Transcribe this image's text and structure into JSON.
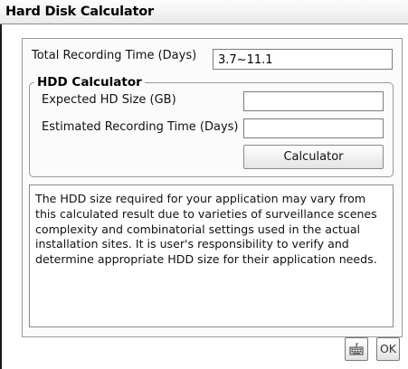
{
  "window": {
    "title": "Hard Disk Calculator"
  },
  "recording": {
    "total_label": "Total Recording Time (Days)",
    "total_value": "3.7~11.1"
  },
  "hdd_calculator": {
    "group_title": "HDD Calculator",
    "expected_size_label": "Expected HD Size (GB)",
    "expected_size_value": "",
    "estimated_time_label": "Estimated Recording Time (Days)",
    "estimated_time_value": "",
    "calculate_button": "Calculator"
  },
  "notice": {
    "text": "The HDD size required for your application may vary from this calculated result due to varieties of surveillance scenes complexity and combinatorial settings used in the actual installation sites. It is user's responsibility to verify and determine appropriate HDD size for their application needs."
  },
  "footer": {
    "keyboard_icon": "keyboard-icon",
    "ok_label": "OK"
  }
}
